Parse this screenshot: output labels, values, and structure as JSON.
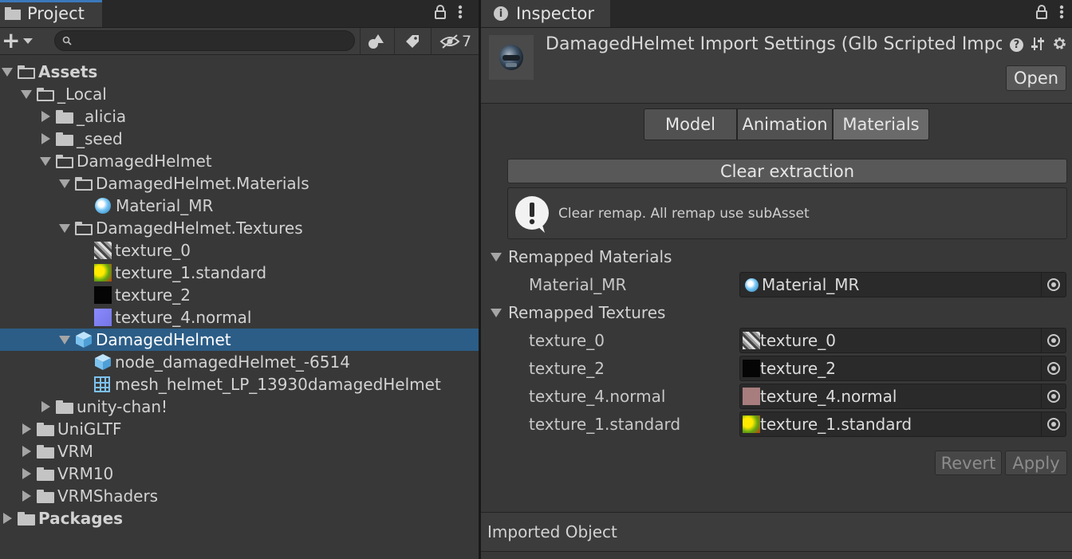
{
  "project": {
    "tab_title": "Project",
    "toolbar": {
      "add_label": "+",
      "search_placeholder": "",
      "hidden_count": "7"
    },
    "tree": [
      {
        "label": "Assets",
        "depth": 0,
        "expanded": true,
        "icon": "folder-open",
        "bold": true
      },
      {
        "label": "_Local",
        "depth": 1,
        "expanded": true,
        "icon": "folder-open"
      },
      {
        "label": "_alicia",
        "depth": 2,
        "expanded": false,
        "icon": "folder"
      },
      {
        "label": "_seed",
        "depth": 2,
        "expanded": false,
        "icon": "folder"
      },
      {
        "label": "DamagedHelmet",
        "depth": 2,
        "expanded": true,
        "icon": "folder-open"
      },
      {
        "label": "DamagedHelmet.Materials",
        "depth": 3,
        "expanded": true,
        "icon": "folder-open"
      },
      {
        "label": "Material_MR",
        "depth": 4,
        "icon": "material"
      },
      {
        "label": "DamagedHelmet.Textures",
        "depth": 3,
        "expanded": true,
        "icon": "folder-open"
      },
      {
        "label": "texture_0",
        "depth": 4,
        "icon": "texture-0"
      },
      {
        "label": "texture_1.standard",
        "depth": 4,
        "icon": "texture-1"
      },
      {
        "label": "texture_2",
        "depth": 4,
        "icon": "texture-2"
      },
      {
        "label": "texture_4.normal",
        "depth": 4,
        "icon": "texture-4"
      },
      {
        "label": "DamagedHelmet",
        "depth": 3,
        "expanded": true,
        "icon": "prefab",
        "selected": true
      },
      {
        "label": "node_damagedHelmet_-6514",
        "depth": 4,
        "icon": "prefab"
      },
      {
        "label": "mesh_helmet_LP_13930damagedHelmet",
        "depth": 4,
        "icon": "mesh"
      },
      {
        "label": "unity-chan!",
        "depth": 2,
        "expanded": false,
        "icon": "folder"
      },
      {
        "label": "UniGLTF",
        "depth": 1,
        "expanded": false,
        "icon": "folder"
      },
      {
        "label": "VRM",
        "depth": 1,
        "expanded": false,
        "icon": "folder"
      },
      {
        "label": "VRM10",
        "depth": 1,
        "expanded": false,
        "icon": "folder"
      },
      {
        "label": "VRMShaders",
        "depth": 1,
        "expanded": false,
        "icon": "folder"
      },
      {
        "label": "Packages",
        "depth": 0,
        "expanded": false,
        "icon": "folder",
        "bold": true
      }
    ]
  },
  "inspector": {
    "tab_title": "Inspector",
    "header_title": "DamagedHelmet Import Settings (Glb Scripted Impor",
    "open_button": "Open",
    "tabs": [
      "Model",
      "Animation",
      "Materials"
    ],
    "active_tab": "Materials",
    "clear_extraction": "Clear extraction",
    "info_message": "Clear remap. All remap use subAsset",
    "remapped_materials": {
      "title": "Remapped Materials",
      "rows": [
        {
          "label": "Material_MR",
          "value": "Material_MR"
        }
      ]
    },
    "remapped_textures": {
      "title": "Remapped Textures",
      "rows": [
        {
          "label": "texture_0",
          "value": "texture_0"
        },
        {
          "label": "texture_2",
          "value": "texture_2"
        },
        {
          "label": "texture_4.normal",
          "value": "texture_4.normal"
        },
        {
          "label": "texture_1.standard",
          "value": "texture_1.standard"
        }
      ]
    },
    "revert_button": "Revert",
    "apply_button": "Apply",
    "imported_object": "Imported Object"
  }
}
